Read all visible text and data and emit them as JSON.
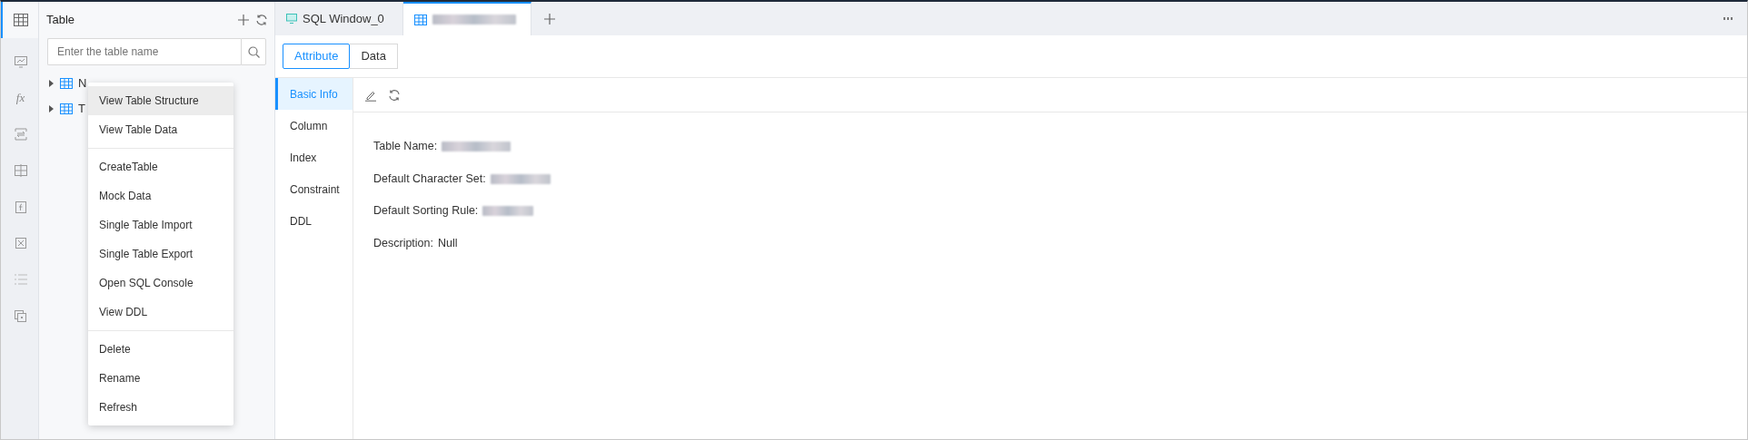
{
  "rail": [
    {
      "kind": "grid",
      "selected": true
    },
    {
      "kind": "monitor",
      "selected": false
    },
    {
      "kind": "text",
      "label": "fx",
      "selected": false
    },
    {
      "kind": "swap",
      "selected": false
    },
    {
      "kind": "cross",
      "selected": false
    },
    {
      "kind": "fbox",
      "selected": false
    },
    {
      "kind": "xbox",
      "selected": false
    },
    {
      "kind": "list",
      "selected": false
    },
    {
      "kind": "copy",
      "selected": false
    }
  ],
  "panel": {
    "title": "Table",
    "search": {
      "placeholder": "Enter the table name"
    },
    "tree": [
      {
        "label": "N",
        "expanded": false
      },
      {
        "label": "T",
        "expanded": false
      }
    ]
  },
  "context_menu": {
    "groups": [
      [
        {
          "label": "View Table Structure",
          "selected": true
        },
        {
          "label": "View Table Data",
          "selected": false
        }
      ],
      [
        {
          "label": "CreateTable",
          "selected": false
        },
        {
          "label": "Mock Data",
          "selected": false
        },
        {
          "label": "Single Table Import",
          "selected": false
        },
        {
          "label": "Single Table Export",
          "selected": false
        },
        {
          "label": "Open SQL Console",
          "selected": false
        },
        {
          "label": "View DDL",
          "selected": false
        }
      ],
      [
        {
          "label": "Delete",
          "selected": false
        },
        {
          "label": "Rename",
          "selected": false
        },
        {
          "label": "Refresh",
          "selected": false
        }
      ]
    ]
  },
  "tabs": [
    {
      "kind": "text",
      "label": "SQL Window_0",
      "selected": false
    },
    {
      "kind": "blurred",
      "selected": true
    }
  ],
  "view_switch": [
    {
      "label": "Attribute",
      "selected": true
    },
    {
      "label": "Data",
      "selected": false
    }
  ],
  "sections": [
    {
      "label": "Basic Info",
      "selected": true
    },
    {
      "label": "Column",
      "selected": false
    },
    {
      "label": "Index",
      "selected": false
    },
    {
      "label": "Constraint",
      "selected": false
    },
    {
      "label": "DDL",
      "selected": false
    }
  ],
  "properties": [
    {
      "label": "Table Name:",
      "kind": "blurred"
    },
    {
      "label": "Default Character Set:",
      "kind": "blurred"
    },
    {
      "label": "Default Sorting Rule:",
      "kind": "blurred"
    },
    {
      "label": "Description:",
      "kind": "text",
      "value": "Null"
    }
  ]
}
